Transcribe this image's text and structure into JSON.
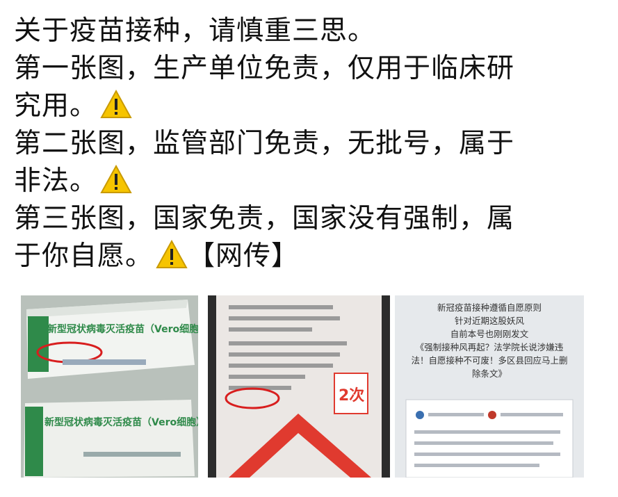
{
  "post": {
    "lines": [
      "关于疫苗接种，请慎重三思。",
      "第一张图，生产单位免责，仅用于临床研",
      "究用。",
      "第二张图，监管部门免责，无批号，属于",
      "非法。",
      "第三张图，国家免责，国家没有强制，属",
      "于你自愿。",
      "【网传】"
    ]
  },
  "images": {
    "img1": {
      "box_title_top": "新型冠状病毒灭活疫苗（Vero细胞）",
      "box_title_bottom": "新型冠状病毒灭活疫苗（Vero细胞）"
    },
    "img2": {
      "badge": "2次"
    },
    "img3": {
      "headline_1": "新冠疫苗接种遵循自愿原则",
      "headline_2": "针对近期这股妖风",
      "headline_3": "自前本号也刚刚发文",
      "headline_4": "《强制接种风再起？法学院长说涉嫌违",
      "headline_5": "法！自愿接种不可废！多区县回应马上删",
      "headline_6": "除条文》"
    }
  },
  "colors": {
    "warning_yellow": "#f6c400",
    "warning_border": "#c99a00",
    "circle_red": "#d81e1e",
    "badge_red": "#e03a2f",
    "box_green": "#2f8a4a"
  }
}
